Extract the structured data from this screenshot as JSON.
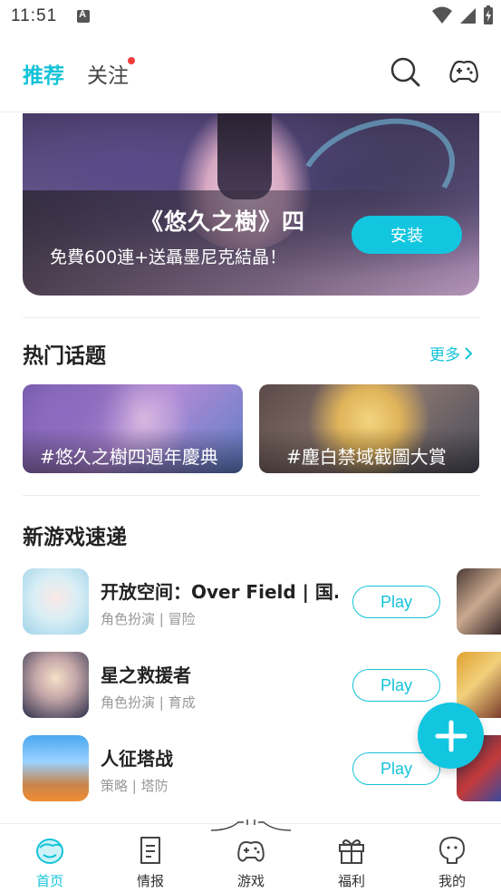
{
  "status_bar": {
    "time": "11:51"
  },
  "top_nav": {
    "tabs": [
      {
        "label": "推荐",
        "active": true
      },
      {
        "label": "关注",
        "active": false,
        "has_dot": true
      }
    ],
    "icons": [
      "search-icon",
      "gamepad-icon"
    ]
  },
  "banner": {
    "title": "《悠久之樹》四",
    "subtitle": "免費600連+送聶墨尼克結晶！",
    "install_label": "安装"
  },
  "hot_topics": {
    "title": "热门话题",
    "more_label": "更多",
    "items": [
      {
        "label": "#悠久之樹四週年慶典"
      },
      {
        "label": "#塵白禁域截圖大賞"
      }
    ]
  },
  "new_games": {
    "title": "新游戏速递",
    "items": [
      {
        "name": "开放空间：Over Field | 国...",
        "tags": "角色扮演 | 冒险",
        "play_label": "Play"
      },
      {
        "name": "星之救援者",
        "tags": "角色扮演 | 育成",
        "play_label": "Play"
      },
      {
        "name": "人征塔战",
        "tags": "策略 | 塔防",
        "play_label": "Play"
      }
    ]
  },
  "bottom_nav": {
    "items": [
      {
        "label": "首页",
        "icon": "home-icon",
        "active": true
      },
      {
        "label": "情报",
        "icon": "news-icon",
        "active": false
      },
      {
        "label": "游戏",
        "icon": "game-controller-icon",
        "active": false
      },
      {
        "label": "福利",
        "icon": "gift-icon",
        "active": false
      },
      {
        "label": "我的",
        "icon": "profile-icon",
        "active": false
      }
    ]
  },
  "colors": {
    "accent": "#14c3d8",
    "dot": "#f03c3c"
  }
}
